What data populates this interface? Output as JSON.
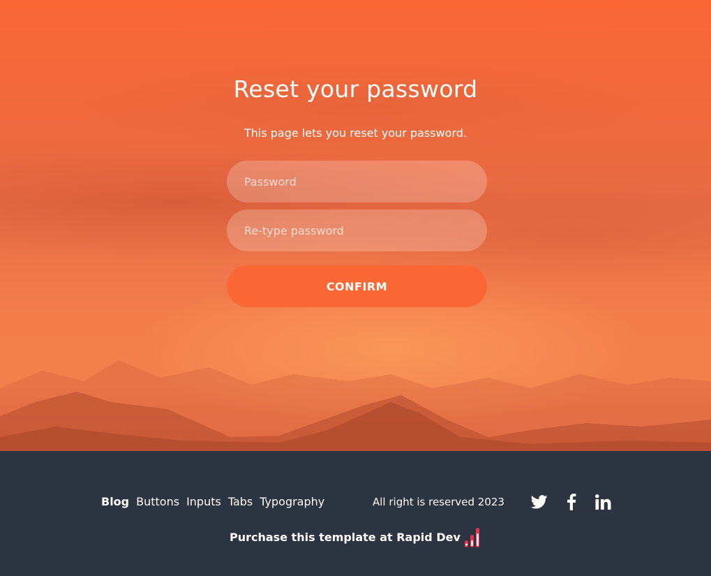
{
  "page": {
    "title": "Reset your password",
    "subtitle": "This page lets you reset your password."
  },
  "form": {
    "password_placeholder": "Password",
    "retype_placeholder": "Re-type password",
    "confirm_label": "CONFIRM"
  },
  "footer": {
    "nav": [
      {
        "label": "Blog",
        "active": true
      },
      {
        "label": "Buttons",
        "active": false
      },
      {
        "label": "Inputs",
        "active": false
      },
      {
        "label": "Tabs",
        "active": false
      },
      {
        "label": "Typography",
        "active": false
      }
    ],
    "copyright": "All right is reserved 2023",
    "social": [
      {
        "icon": "twitter-icon"
      },
      {
        "icon": "facebook-icon"
      },
      {
        "icon": "linkedin-icon"
      }
    ],
    "purchase_text": "Purchase this template at Rapid Dev",
    "logo_icon": "rapid-dev-logo-icon"
  },
  "colors": {
    "accent": "#fb6735",
    "footer_bg": "#2c3442",
    "logo_red": "#e8344a"
  }
}
